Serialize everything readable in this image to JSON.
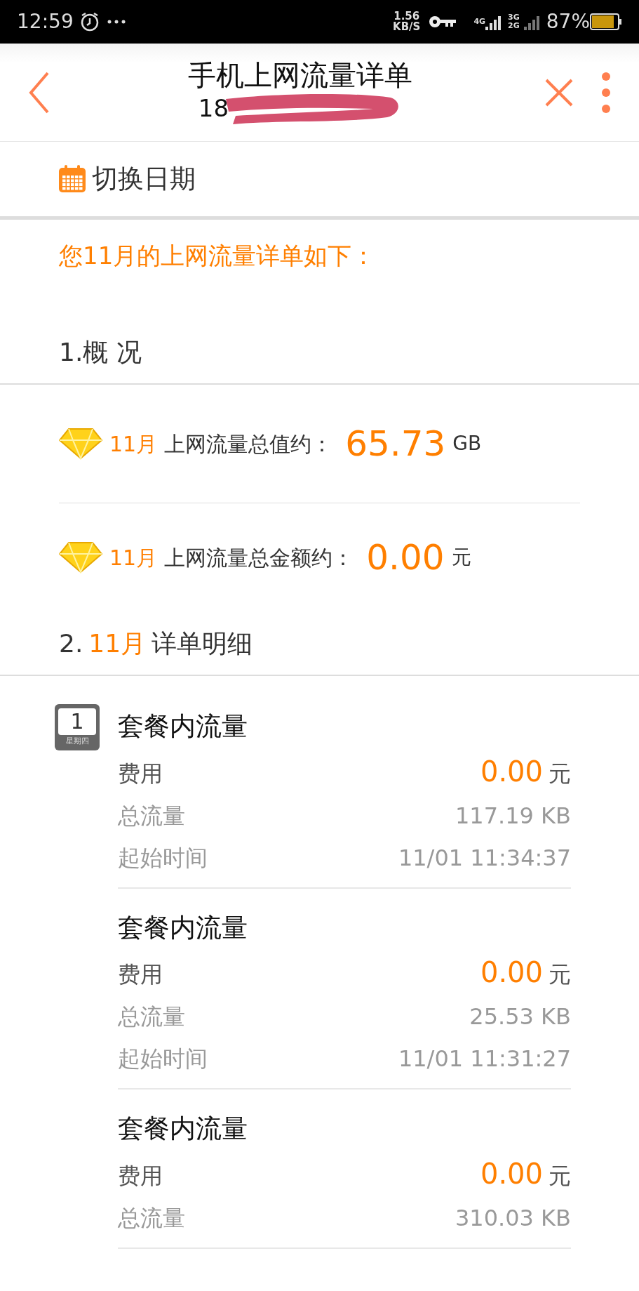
{
  "status_bar": {
    "time": "12:59",
    "speed": "1.56",
    "speed_unit": "KB/S",
    "net_labels": [
      "4G",
      "3G",
      "2G"
    ],
    "battery": "87%"
  },
  "header": {
    "title": "手机上网流量详单",
    "subtitle": "18"
  },
  "date_switch": {
    "label": "切换日期"
  },
  "intro": "您11月的上网流量详单如下：",
  "section_1": {
    "title": "1.概 况"
  },
  "summary": [
    {
      "month": "11月",
      "label": "上网流量总值约：",
      "value": "65.73",
      "unit": "GB"
    },
    {
      "month": "11月",
      "label": "上网流量总金额约：",
      "value": "0.00",
      "unit": "元"
    }
  ],
  "section_2": {
    "number": "2.",
    "month": "11月",
    "title": "详单明细"
  },
  "days": [
    {
      "day": "1",
      "weekday": "星期四",
      "records": [
        {
          "title": "套餐内流量",
          "fee_label": "费用",
          "fee": "0.00",
          "fee_unit": "元",
          "total_label": "总流量",
          "total": "117.19 KB",
          "start_label": "起始时间",
          "start": "11/01 11:34:37"
        },
        {
          "title": "套餐内流量",
          "fee_label": "费用",
          "fee": "0.00",
          "fee_unit": "元",
          "total_label": "总流量",
          "total": "25.53 KB",
          "start_label": "起始时间",
          "start": "11/01 11:31:27"
        },
        {
          "title": "套餐内流量",
          "fee_label": "费用",
          "fee": "0.00",
          "fee_unit": "元",
          "total_label": "总流量",
          "total": "310.03 KB"
        }
      ]
    }
  ]
}
